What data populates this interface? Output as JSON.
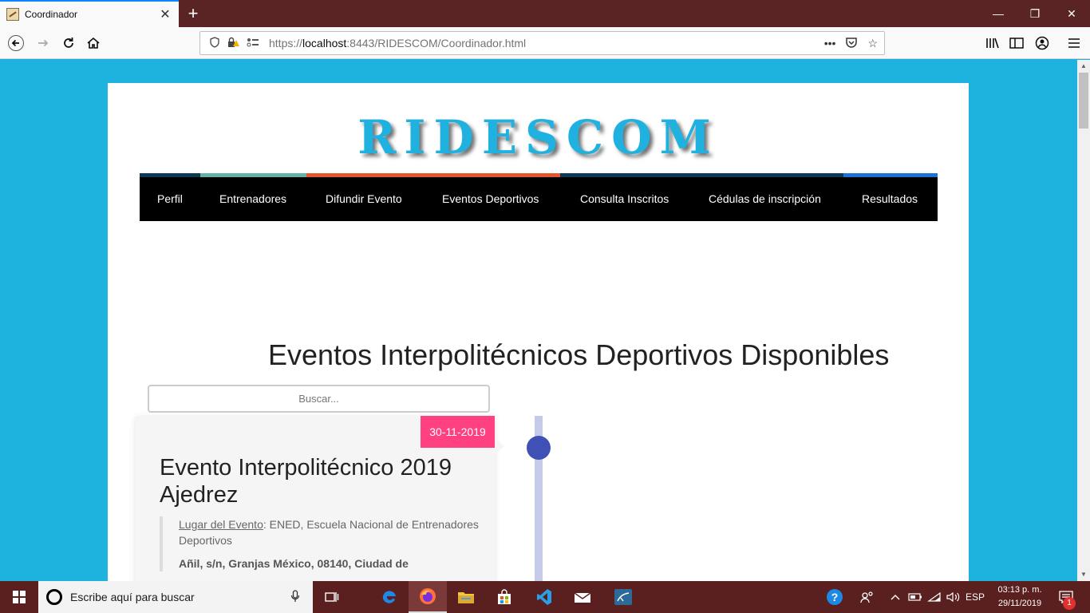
{
  "browser": {
    "tab_title": "Coordinador",
    "tab_close": "✕",
    "new_tab": "+",
    "url_prefix": "https://",
    "url_host": "localhost",
    "url_rest": ":8443/RIDESCOM/Coordinador.html",
    "more_actions": "•••",
    "window_controls": {
      "minimize": "—",
      "restore": "❐",
      "close": "✕"
    }
  },
  "site": {
    "logo": "RIDESCOM",
    "menu": [
      "Perfil",
      "Entrenadores",
      "Difundir Evento",
      "Eventos Deportivos",
      "Consulta Inscritos",
      "Cédulas de inscripción",
      "Resultados"
    ],
    "strip_colors": [
      "#0c3a52",
      "#64b2a6",
      "#e4572e",
      "#e4572e",
      "#0c3a52",
      "#1a74d6"
    ]
  },
  "main": {
    "section_title": "Eventos Interpolitécnicos Deportivos Disponibles",
    "search_placeholder": "Buscar...",
    "events": [
      {
        "date": "30-11-2019",
        "title": "Evento Interpolitécnico 2019 Ajedrez",
        "location_label": "Lugar del Evento",
        "location_value": ": ENED, Escuela Nacional de Entrenadores Deportivos",
        "address": "Añil, s/n, Granjas México, 08140, Ciudad de"
      }
    ]
  },
  "taskbar": {
    "search_placeholder": "Escribe aquí para buscar",
    "language": "ESP",
    "time": "03:13 p. m.",
    "date": "29/11/2019",
    "notification_count": "1"
  },
  "colors": {
    "background": "#1eb2de",
    "logo": "#1fb1df",
    "date_badge": "#ff4081",
    "timeline_dot": "#3f51b5",
    "timeline_line": "#c5cae9"
  }
}
